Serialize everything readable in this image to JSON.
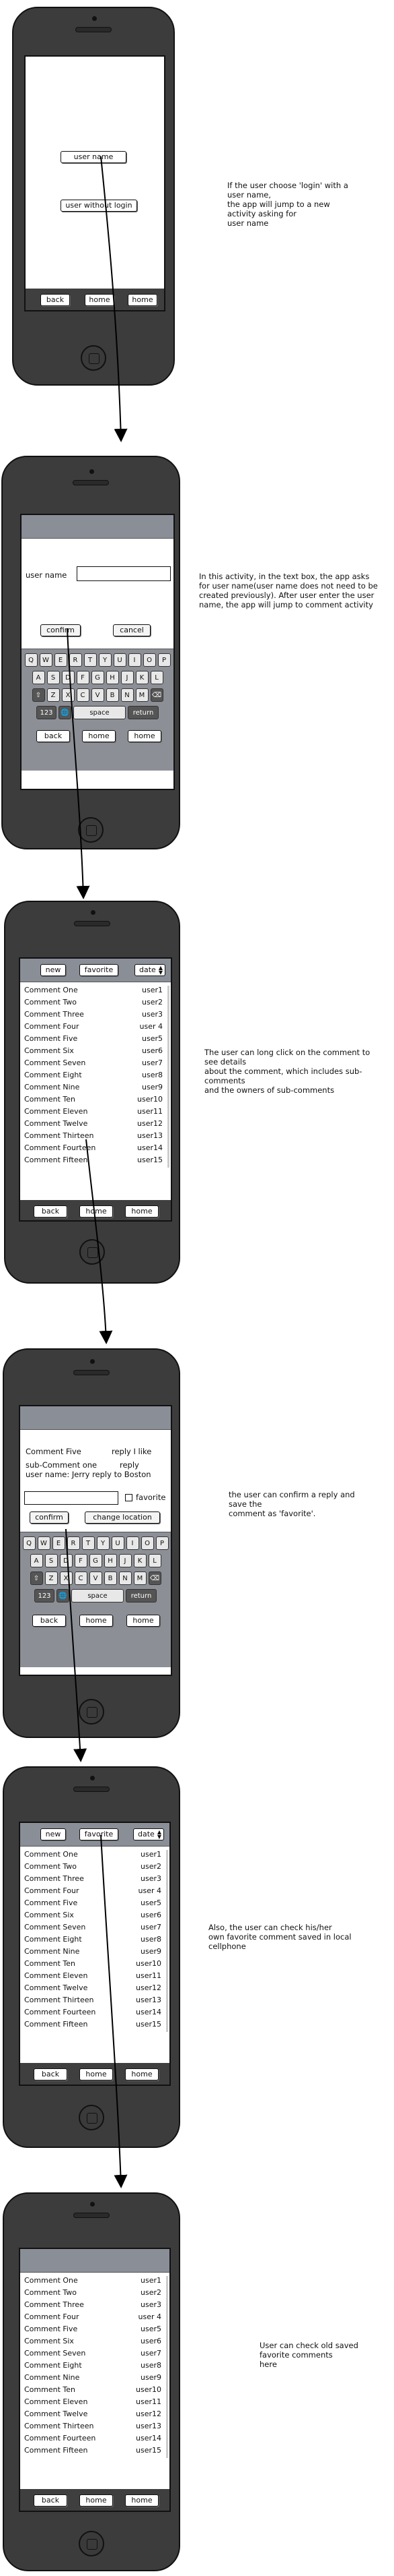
{
  "annotations": {
    "login_choice": [
      "If the user choose 'login' with a",
      "user name,",
      "the app will jump to a new",
      "activity asking for",
      "user name"
    ],
    "username_entry": [
      "In this activity, in the text box, the app asks",
      "for user name(user name does not need to be",
      "created previously). After user enter the user",
      "name, the app will jump to comment activity"
    ],
    "long_click": [
      "The user can long click on the comment to",
      "see details",
      "about the comment, which includes sub-",
      "comments",
      "and the owners of sub-comments"
    ],
    "reply_save": [
      "the user can confirm a reply and",
      "save the",
      "comment as 'favorite'."
    ],
    "favorites_check": [
      "Also, the user can check his/her",
      "own favorite comment saved in local",
      "cellphone"
    ],
    "old_favorites": [
      "User can check old saved",
      "favorite comments",
      "here"
    ]
  },
  "nav": {
    "back": "back",
    "home": "home",
    "home2": "home"
  },
  "screen1": {
    "user_name_button": "user name",
    "no_login_button": "user without login"
  },
  "screen2": {
    "label": "user name",
    "confirm": "confirm",
    "cancel": "cancel"
  },
  "keyboard": {
    "row1": [
      "Q",
      "W",
      "E",
      "R",
      "T",
      "Y",
      "U",
      "I",
      "O",
      "P"
    ],
    "row2": [
      "A",
      "S",
      "D",
      "F",
      "G",
      "H",
      "J",
      "K",
      "L"
    ],
    "row3": [
      "Z",
      "X",
      "C",
      "V",
      "B",
      "N",
      "M"
    ],
    "shift": "⇧",
    "backspace": "⌫",
    "numbers": "123",
    "globe": "🌐",
    "space": "space",
    "return": "return"
  },
  "list_toolbar": {
    "new": "new",
    "favorite": "favorite",
    "sort": "date"
  },
  "comments": [
    {
      "text": "Comment One",
      "user": "user1"
    },
    {
      "text": "Comment Two",
      "user": "user2"
    },
    {
      "text": "Comment  Three",
      "user": "user3"
    },
    {
      "text": "Comment Four",
      "user": "user 4"
    },
    {
      "text": "Comment Five",
      "user": "user5"
    },
    {
      "text": "Comment  Six",
      "user": "user6"
    },
    {
      "text": "Comment Seven",
      "user": "user7"
    },
    {
      "text": "Comment Eight",
      "user": "user8"
    },
    {
      "text": "Comment  Nine",
      "user": "user9"
    },
    {
      "text": "Comment Ten",
      "user": "user10"
    },
    {
      "text": "Comment Eleven",
      "user": "user11"
    },
    {
      "text": "Comment  Twelve",
      "user": "user12"
    },
    {
      "text": "Comment Thirteen",
      "user": "user13"
    },
    {
      "text": "Comment Fourteen",
      "user": "user14"
    },
    {
      "text": "Comment  Fifteen",
      "user": "user15"
    }
  ],
  "screen4": {
    "comment": "Comment Five",
    "reply_link": "reply I like",
    "sub_comment": "sub-Comment one",
    "reply2": "reply",
    "user_line": "user name: Jerry reply to Boston",
    "favorite_label": "favorite",
    "confirm": "confirm",
    "change_location": "change location"
  }
}
